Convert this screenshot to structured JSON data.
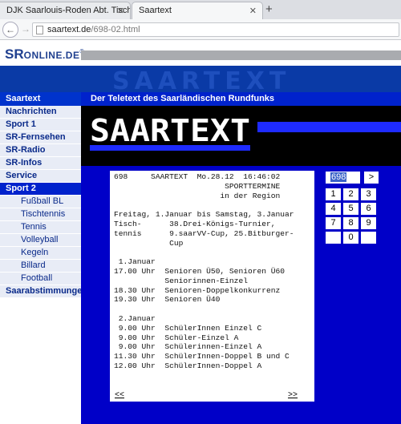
{
  "browser": {
    "tabs": [
      {
        "label": "DJK Saarlouis-Roden Abt. Tisch..."
      },
      {
        "label": "Saartext"
      }
    ],
    "url_domain": "saartext.de",
    "url_path": "/698-02.html"
  },
  "site": {
    "logo_sr": "SR",
    "logo_online": "ONLINE.DE",
    "banner_watermark": "SAARTEXT",
    "subtitle": "Der Teletext des Saarländischen Rundfunks",
    "teletext_logo": "SAARTEXT"
  },
  "sidebar": {
    "header": "Saartext",
    "items": [
      {
        "label": "Nachrichten"
      },
      {
        "label": "Sport 1"
      },
      {
        "label": "SR-Fernsehen"
      },
      {
        "label": "SR-Radio"
      },
      {
        "label": "SR-Infos"
      },
      {
        "label": "Service"
      },
      {
        "label": "Sport 2"
      }
    ],
    "subitems": [
      {
        "label": "Fußball BL"
      },
      {
        "label": "Tischtennis"
      },
      {
        "label": "Tennis"
      },
      {
        "label": "Volleyball"
      },
      {
        "label": "Kegeln"
      },
      {
        "label": "Billard"
      },
      {
        "label": "Football"
      }
    ],
    "last": "Saarabstimmungen"
  },
  "teletext": {
    "lines": [
      "698     SAARTEXT  Mo.28.12  16:46:02",
      "                        SPORTTERMINE",
      "                       in der Region",
      "",
      "Freitag, 1.Januar bis Samstag, 3.Januar",
      "Tisch-      38.Drei-Königs-Turnier,",
      "tennis      9.saarVV-Cup, 25.Bitburger-",
      "            Cup",
      "",
      " 1.Januar",
      "17.00 Uhr  Senioren Ü50, Senioren Ü60",
      "           Seniorinnen-Einzel",
      "18.30 Uhr  Senioren-Doppelkonkurrenz",
      "19.30 Uhr  Senioren Ü40",
      "",
      " 2.Januar",
      " 9.00 Uhr  SchülerInnen Einzel C",
      " 9.00 Uhr  Schüler-Einzel A",
      " 9.00 Uhr  Schülerinnen-Einzel A",
      "11.30 Uhr  SchülerInnen-Doppel B und C",
      "12.00 Uhr  SchülerInnen-Doppel A"
    ],
    "prev": "<<",
    "next": ">>"
  },
  "keypad": {
    "page_value": "698",
    "go_label": ">",
    "keys": [
      "1",
      "2",
      "3",
      "4",
      "5",
      "6",
      "7",
      "8",
      "9",
      "",
      "0",
      ""
    ]
  }
}
